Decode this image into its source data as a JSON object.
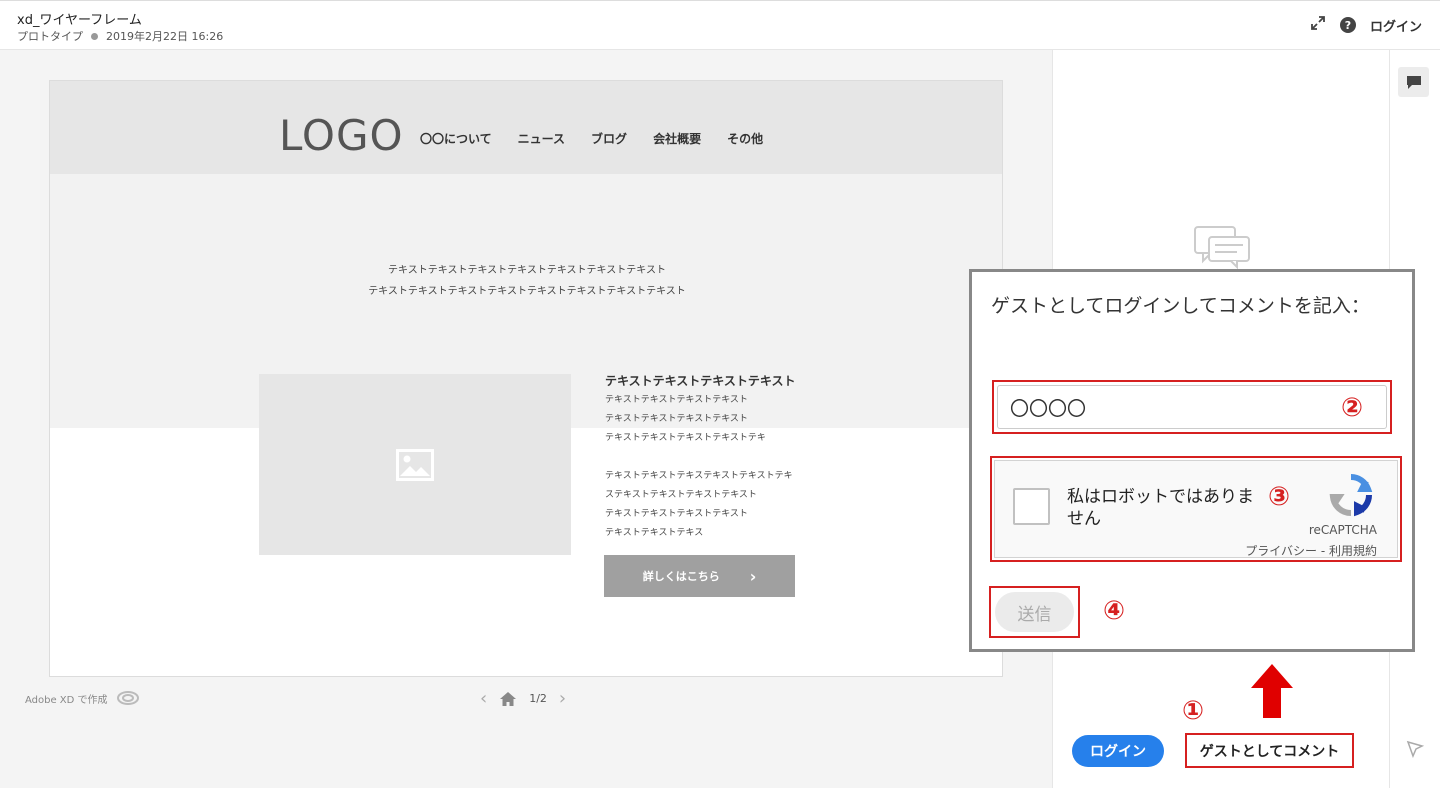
{
  "header": {
    "title": "xd_ワイヤーフレーム",
    "subtitle": "プロトタイプ",
    "timestamp": "2019年2月22日 16:26",
    "help_icon": "?",
    "login_label": "ログイン"
  },
  "artboard": {
    "logo": "LOGO",
    "nav": [
      "〇〇について",
      "ニュース",
      "ブログ",
      "会社概要",
      "その他"
    ],
    "hero_lines": [
      "テキストテキストテキストテキストテキストテキストテキスト",
      "テキストテキストテキストテキストテキストテキストテキストテキスト"
    ],
    "side_title": "テキストテキストテキストテキスト",
    "side_block1": [
      "テキストテキストテキストテキスト",
      "テキストテキストテキストテキスト",
      "テキストテキストテキストテキストテキ"
    ],
    "side_block2": [
      "テキストテキストテキステキストテキストテキ",
      "ステキストテキストテキストテキスト",
      "テキストテキストテキストテキスト",
      "テキストテキストテキス"
    ],
    "more_button": "詳しくはこちら",
    "more_chevron": "›"
  },
  "footer": {
    "made_with": "Adobe XD で作成",
    "page_indicator": "1/2",
    "prev": "‹",
    "next": "›"
  },
  "comment_popup": {
    "title": "ゲストとしてログインしてコメントを記入：",
    "name_value": "〇〇〇〇",
    "captcha_label": "私はロボットではありません",
    "captcha_brand": "reCAPTCHA",
    "captcha_links": "プライバシー - 利用規約",
    "submit": "送信"
  },
  "annotations": {
    "n1": "①",
    "n2": "②",
    "n3": "③",
    "n4": "④"
  },
  "panel_footer": {
    "login": "ログイン",
    "guest_comment": "ゲストとしてコメント"
  },
  "colors": {
    "accent": "#2680eb",
    "annotation": "#d62020"
  }
}
